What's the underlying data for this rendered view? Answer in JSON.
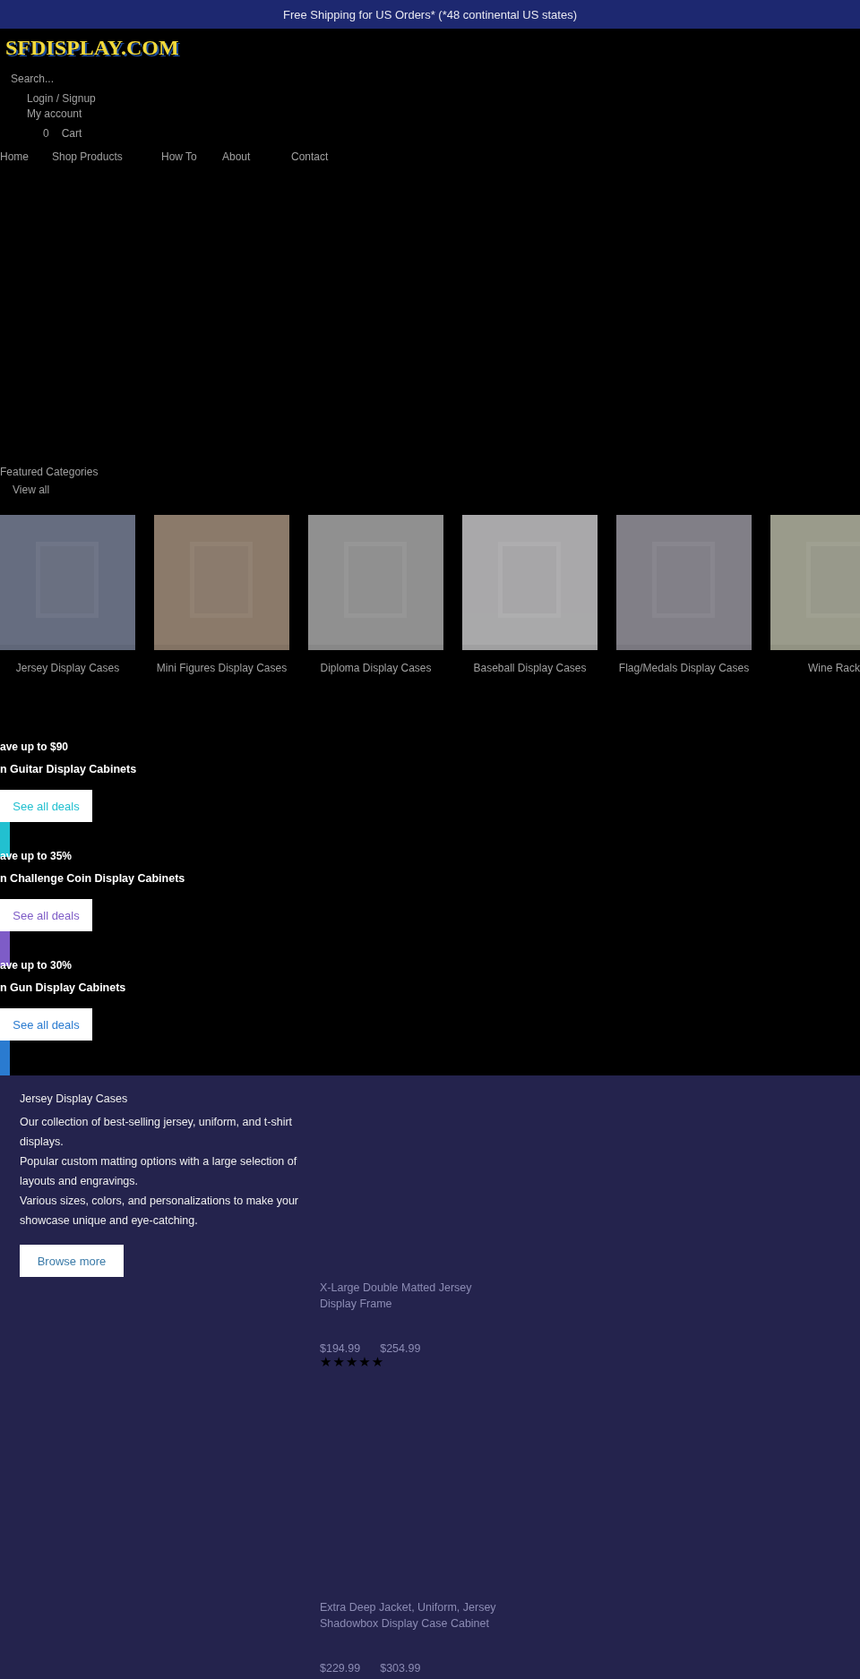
{
  "announcement": "Free Shipping for US Orders* (*48 continental US states)",
  "logo": "SFDISPLAY.COM",
  "search": {
    "placeholder": "Search..."
  },
  "account_links": [
    "Login / Signup",
    "My account"
  ],
  "cart": {
    "count": "0",
    "label": "Cart"
  },
  "nav": [
    "Home",
    "Shop Products",
    "How To",
    "About",
    "Contact"
  ],
  "featured": {
    "title": "Featured Categories",
    "link": "View all",
    "categories": [
      {
        "label": "Jersey Display Cases",
        "kind": "picture"
      },
      {
        "label": "Mini Figures Display Cases",
        "kind": "picture"
      },
      {
        "label": "Diploma Display Cases",
        "kind": "picture"
      },
      {
        "label": "Baseball Display Cases",
        "kind": "picture"
      },
      {
        "label": "Flag/Medals Display Cases",
        "kind": "picture"
      },
      {
        "label": "Wine Rack",
        "kind": "picture"
      }
    ]
  },
  "deals": [
    {
      "headline": "ave up to $90",
      "subtitle": "n Guitar Display Cabinets",
      "button": "See all deals",
      "color": "#22c0d0"
    },
    {
      "headline": "ave up to 35%",
      "subtitle": "n Challenge Coin Display Cabinets",
      "button": "See all deals",
      "color": "#7e5cc7"
    },
    {
      "headline": "ave up to 30%",
      "subtitle": "n Gun Display Cabinets",
      "button": "See all deals",
      "color": "#2a7bd0"
    }
  ],
  "collection": {
    "title": "Jersey Display Cases",
    "description": [
      "Our collection of best-selling jersey, uniform, and t-shirt displays.",
      "Popular custom matting options with a large selection of layouts and engravings.",
      "Various sizes, colors, and personalizations to make your showcase unique and eye-catching."
    ],
    "button": "Browse more",
    "products": [
      {
        "title": "X-Large Double Matted Jersey Display Frame",
        "price": "$194.99",
        "compare_price": "$254.99",
        "stars": 5
      },
      {
        "title": "Extra Deep Jacket, Uniform, Jersey Shadowbox Display Case Cabinet",
        "price": "$229.99",
        "compare_price": "$303.99"
      }
    ]
  }
}
